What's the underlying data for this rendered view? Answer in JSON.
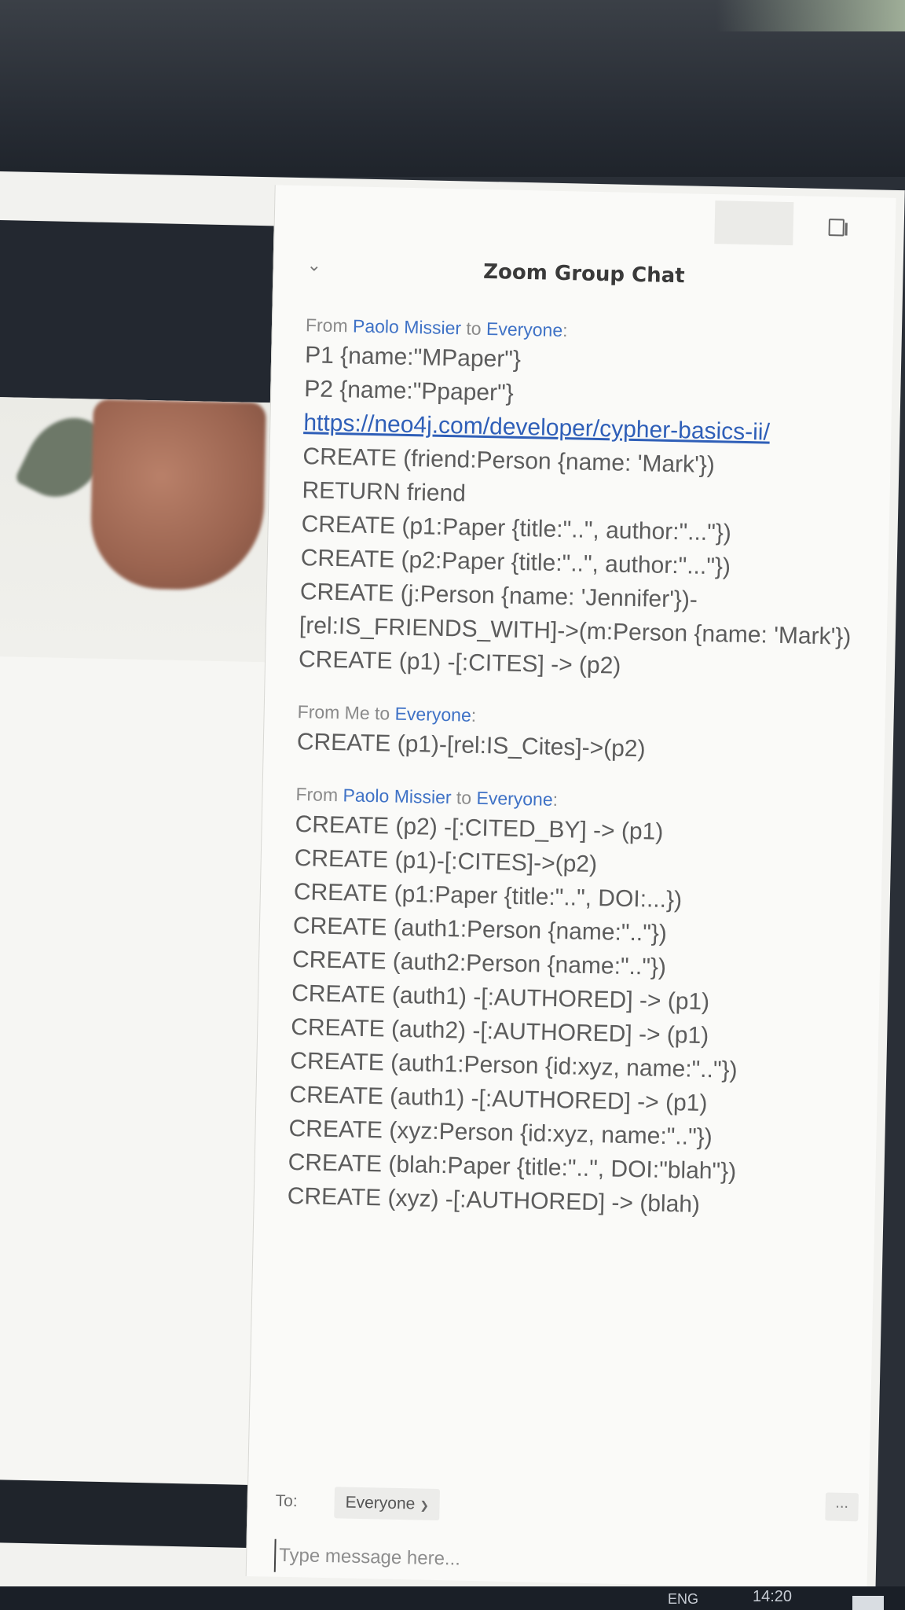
{
  "chat": {
    "title": "Zoom Group Chat",
    "messages": [
      {
        "from_prefix": "From ",
        "sender": "Paolo Missier",
        "mid": " to ",
        "recipient": "Everyone",
        "suffix": ":",
        "lines": [
          {
            "text": "P1 {name:\"MPaper\"}",
            "link": false
          },
          {
            "text": "P2 {name:\"Ppaper\"}",
            "link": false
          },
          {
            "text": "https://neo4j.com/developer/cypher-basics-ii/",
            "link": true
          },
          {
            "text": "CREATE (friend:Person {name: 'Mark'})",
            "link": false
          },
          {
            "text": "RETURN friend",
            "link": false
          },
          {
            "text": "CREATE (p1:Paper {title:\"..\", author:\"...\"})",
            "link": false
          },
          {
            "text": "CREATE (p2:Paper {title:\"..\", author:\"...\"})",
            "link": false
          },
          {
            "text": "CREATE (j:Person {name: 'Jennifer'})-",
            "link": false
          },
          {
            "text": "[rel:IS_FRIENDS_WITH]->(m:Person {name: 'Mark'})",
            "link": false
          },
          {
            "text": "CREATE (p1) -[:CITES] -> (p2)",
            "link": false
          }
        ]
      },
      {
        "from_prefix": "From Me to ",
        "sender": "",
        "mid": "",
        "recipient": "Everyone",
        "suffix": ":",
        "lines": [
          {
            "text": "CREATE (p1)-[rel:IS_Cites]->(p2)",
            "link": false
          }
        ]
      },
      {
        "from_prefix": "From ",
        "sender": "Paolo Missier",
        "mid": " to ",
        "recipient": "Everyone",
        "suffix": ":",
        "lines": [
          {
            "text": "CREATE (p2) -[:CITED_BY] -> (p1)",
            "link": false
          },
          {
            "text": "CREATE (p1)-[:CITES]->(p2)",
            "link": false
          },
          {
            "text": "CREATE (p1:Paper {title:\"..\", DOI:...})",
            "link": false
          },
          {
            "text": "CREATE (auth1:Person {name:\"..\"})",
            "link": false
          },
          {
            "text": "CREATE (auth2:Person {name:\"..\"})",
            "link": false
          },
          {
            "text": "CREATE (auth1) -[:AUTHORED] -> (p1)",
            "link": false
          },
          {
            "text": "CREATE (auth2) -[:AUTHORED] -> (p1)",
            "link": false
          },
          {
            "text": "CREATE (auth1:Person {id:xyz, name:\"..\"})",
            "link": false
          },
          {
            "text": "CREATE (auth1) -[:AUTHORED] -> (p1)",
            "link": false
          },
          {
            "text": "CREATE (xyz:Person {id:xyz, name:\"..\"})",
            "link": false
          },
          {
            "text": "CREATE (blah:Paper {title:\"..\", DOI:\"blah\"})",
            "link": false
          },
          {
            "text": "CREATE (xyz) -[:AUTHORED] -> (blah)",
            "link": false
          }
        ]
      }
    ]
  },
  "composer": {
    "to_label": "To:",
    "to_value": "Everyone",
    "more_label": "...",
    "placeholder": "Type message here..."
  },
  "taskbar": {
    "lang": "ENG",
    "time": "14:20"
  },
  "icons": {
    "collapse": "chevron-down-icon",
    "popout": "popout-window-icon",
    "dropdown": "chevron-down-icon"
  },
  "colors": {
    "link": "#3f72c6",
    "text": "#5c5c5c"
  }
}
